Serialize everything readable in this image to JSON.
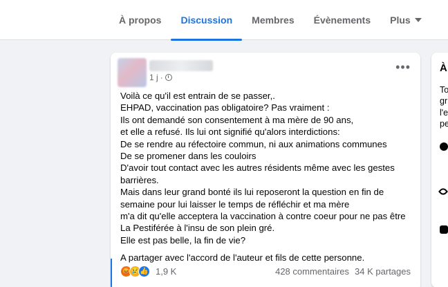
{
  "nav": {
    "tabs": [
      {
        "label": "À propos",
        "active": false
      },
      {
        "label": "Discussion",
        "active": true
      },
      {
        "label": "Membres",
        "active": false
      },
      {
        "label": "Évènements",
        "active": false
      },
      {
        "label": "Plus",
        "active": false
      }
    ]
  },
  "post": {
    "time": "1 j",
    "separator": "·",
    "more_label": "•••",
    "lines": [
      "Voilà ce qu'il est entrain de se passer,.",
      "EHPAD, vaccination pas obligatoire? Pas vraiment :",
      "Ils ont demandé son consentement à ma mère de 90 ans,",
      "et elle a refusé. Ils lui ont signifié qu'alors interdictions:",
      "De se rendre au réfectoire commun, ni aux animations communes",
      "De se promener dans les couloirs",
      "D'avoir tout contact avec les autres résidents même avec les gestes",
      "barrières.",
      "Mais dans leur grand bonté ils lui reposeront la question en fin de",
      "semaine pour lui laisser le temps de réfléchir et ma mère",
      "m'a dit qu'elle acceptera la vaccination à contre coeur pour ne pas être",
      "La Pestiférée à l'insu de son plein gré.",
      "Elle est pas belle, la fin de vie?"
    ],
    "footer_line": "A partager avec l'accord de l'auteur et fils de cette personne.",
    "reaction_count": "1,9 K",
    "comments": "428 commentaires",
    "shares": "34 K partages",
    "colors": {
      "like": "#1877f2",
      "angry": "#e9710f",
      "sad": "#f7b125"
    },
    "reaction_icons": [
      "angry-icon",
      "sad-icon",
      "like-icon"
    ]
  },
  "sidebar": {
    "title": "À",
    "lines": [
      "To",
      "gr",
      "l'e",
      "pe"
    ],
    "icons": [
      "globe-icon",
      "eye-icon",
      "group-icon"
    ]
  }
}
